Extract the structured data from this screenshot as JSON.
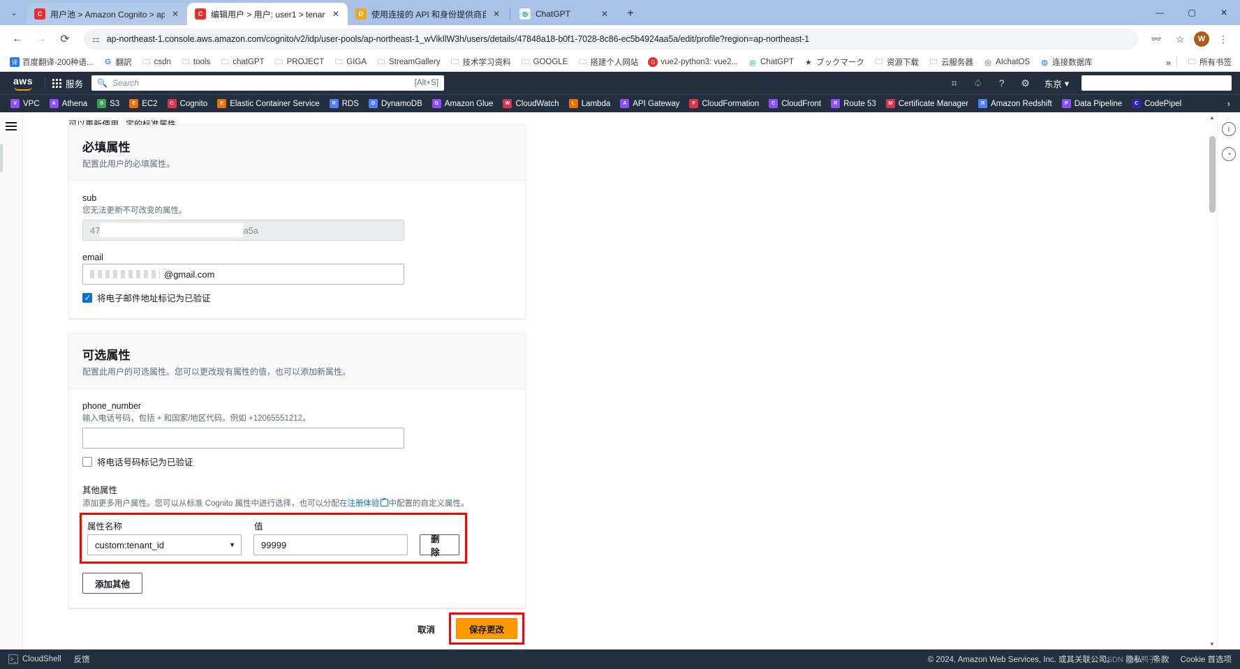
{
  "browser": {
    "tabs": [
      {
        "title": "用户池 > Amazon Cognito > ap",
        "favicon_label": "C",
        "favicon_color": "#e8302a",
        "active": false
      },
      {
        "title": "编辑用户 > 用户: user1 > tenan",
        "favicon_label": "C",
        "favicon_color": "#e8302a",
        "active": true
      },
      {
        "title": "使用连接的 API 和身份提供商自",
        "favicon_label": "D",
        "favicon_color": "#f0a818",
        "active": false
      },
      {
        "title": "ChatGPT",
        "favicon_label": "G",
        "favicon_color": "#75c4a5",
        "active": false
      }
    ],
    "tab_close_label": "✕",
    "new_tab_label": "+",
    "tab_list_label": "⌄",
    "window_controls": {
      "minimize": "—",
      "maximize": "▢",
      "close": "✕"
    },
    "nav": {
      "back": "←",
      "forward": "→",
      "reload": "⟳"
    },
    "url": "ap-northeast-1.console.aws.amazon.com/cognito/v2/idp/user-pools/ap-northeast-1_wVikIlW3h/users/details/47848a18-b0f1-7028-8c86-ec5b4924aa5a/edit/profile?region=ap-northeast-1",
    "site_info_icon": "⚙",
    "toolbar_right": {
      "glasses": "👓",
      "star": "☆",
      "profile_initial": "W",
      "menu": "⋮"
    },
    "bookmarks": [
      {
        "label": "百度翻译-200种语...",
        "icon": "译",
        "color": "#2b7cf0"
      },
      {
        "label": "翻訳",
        "icon": "G",
        "color": "#4285f4"
      },
      {
        "label": "csdn",
        "icon": "folder"
      },
      {
        "label": "tools",
        "icon": "folder"
      },
      {
        "label": "chatGPT",
        "icon": "folder"
      },
      {
        "label": "PROJECT",
        "icon": "folder"
      },
      {
        "label": "GIGA",
        "icon": "folder"
      },
      {
        "label": "StreamGallery",
        "icon": "folder"
      },
      {
        "label": "技术学习资料",
        "icon": "folder"
      },
      {
        "label": "GOOGLE",
        "icon": "folder"
      },
      {
        "label": "搭建个人网站",
        "icon": "folder"
      },
      {
        "label": "vue2-python3: vue2...",
        "icon": "G",
        "color": "#e8302a"
      },
      {
        "label": "ChatGPT",
        "icon": "◎",
        "color": "#75c4a5"
      },
      {
        "label": "ブックマーク",
        "icon": "★",
        "color": "#3c4043"
      },
      {
        "label": "资源下载",
        "icon": "folder"
      },
      {
        "label": "云服务器",
        "icon": "folder"
      },
      {
        "label": "AIchatOS",
        "icon": "◎",
        "color": "#5f6368"
      },
      {
        "label": "连接数据库",
        "icon": "◍",
        "color": "#1a73e8"
      }
    ],
    "bookmarks_overflow": "»",
    "all_bookmarks_label": "所有书签"
  },
  "aws_header": {
    "logo_text": "aws",
    "services_label": "服务",
    "search_placeholder": "Search",
    "search_shortcut": "[Alt+S]",
    "icons": {
      "cloudshell": "⌨",
      "notifications": "🔔",
      "help": "?",
      "settings": "⚙"
    },
    "region_label": "东京",
    "region_caret": "▾"
  },
  "aws_favorites": [
    {
      "label": "VPC",
      "color": "#8c4fff",
      "mark": "V"
    },
    {
      "label": "Athena",
      "color": "#8c4fff",
      "mark": "A"
    },
    {
      "label": "S3",
      "color": "#3fa34c",
      "mark": "S"
    },
    {
      "label": "EC2",
      "color": "#ed7100",
      "mark": "E"
    },
    {
      "label": "Cognito",
      "color": "#dd344c",
      "mark": "C"
    },
    {
      "label": "Elastic Container Service",
      "color": "#ed7100",
      "mark": "E"
    },
    {
      "label": "RDS",
      "color": "#527fff",
      "mark": "R"
    },
    {
      "label": "DynamoDB",
      "color": "#527fff",
      "mark": "D"
    },
    {
      "label": "Amazon Glue",
      "color": "#8c4fff",
      "mark": "G"
    },
    {
      "label": "CloudWatch",
      "color": "#dd344c",
      "mark": "W"
    },
    {
      "label": "Lambda",
      "color": "#ed7100",
      "mark": "L"
    },
    {
      "label": "API Gateway",
      "color": "#8c4fff",
      "mark": "A"
    },
    {
      "label": "CloudFormation",
      "color": "#dd344c",
      "mark": "F"
    },
    {
      "label": "CloudFront",
      "color": "#8c4fff",
      "mark": "C"
    },
    {
      "label": "Route 53",
      "color": "#8c4fff",
      "mark": "R"
    },
    {
      "label": "Certificate Manager",
      "color": "#dd344c",
      "mark": "M"
    },
    {
      "label": "Amazon Redshift",
      "color": "#527fff",
      "mark": "R"
    },
    {
      "label": "Data Pipeline",
      "color": "#8c4fff",
      "mark": "P"
    },
    {
      "label": "CodePipel",
      "color": "#2e27ad",
      "mark": "C"
    }
  ],
  "aws_favorites_more": "›",
  "page": {
    "partial_crumb": "可以更新使用...定的标准属性。",
    "required_section": {
      "title": "必填属性",
      "description": "配置此用户的必填属性。",
      "sub_field": {
        "label": "sub",
        "description": "您无法更新不可改变的属性。",
        "value_prefix": "47",
        "value_suffix": "a5a"
      },
      "email_field": {
        "label": "email",
        "value_suffix": "@gmail.com",
        "checkbox_label": "将电子邮件地址标记为已验证",
        "checkbox_checked": true
      }
    },
    "optional_section": {
      "title": "可选属性",
      "description": "配置此用户的可选属性。您可以更改现有属性的值，也可以添加新属性。",
      "phone_field": {
        "label": "phone_number",
        "description": "输入电话号码，包括 + 和国家/地区代码。例如 +12065551212。",
        "value": "",
        "checkbox_label": "将电话号码标记为已验证",
        "checkbox_checked": false
      },
      "other_attributes": {
        "title": "其他属性",
        "desc_before_link": "添加更多用户属性。您可以从标准 Cognito 属性中进行选择，也可以分配在",
        "link_text": "注册体验",
        "desc_after_link": "中配置的自定义属性。",
        "col_name_header": "属性名称",
        "col_value_header": "值",
        "rows": [
          {
            "attribute": "custom:tenant_id",
            "value": "99999",
            "delete_label": "删除"
          }
        ],
        "add_button_label": "添加其他"
      }
    },
    "actions": {
      "cancel_label": "取消",
      "save_label": "保存更改"
    },
    "right_rail_icons": {
      "info": "i",
      "shortcuts": "◔"
    },
    "highlight_color": "#ff0000"
  },
  "aws_footer": {
    "cloudshell_label": "CloudShell",
    "feedback_label": "反馈",
    "copyright": "© 2024, Amazon Web Services, Inc. 或其关联公司。",
    "privacy_label": "隐私",
    "terms_label": "条款",
    "cookie_label": "Cookie 首选项",
    "watermark": "CSDN @小鸭子"
  }
}
